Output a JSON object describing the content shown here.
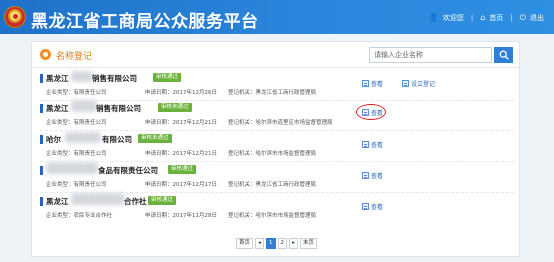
{
  "header": {
    "site_title": "黑龙江省工商局公众服务平台",
    "user_name": "欢迎您",
    "nav_home": "首页",
    "nav_logout": "退出"
  },
  "card": {
    "title": "名称登记",
    "search_placeholder": "请输入企业名称"
  },
  "records": [
    {
      "name_prefix": "黑龙江",
      "name_suffix": "销售有限公司",
      "badge": "审核通过",
      "company_type": "企业类型：有限责任公司",
      "apply_date": "申请日期：2017年12月26日",
      "authority": "登记机关：黑龙江省工商行政管理局",
      "actions": [
        "查看",
        "设立登记"
      ]
    },
    {
      "name_prefix": "黑龙江",
      "name_suffix": "销售有限公司",
      "badge": "审核未通过",
      "company_type": "企业类型：有限责任公司",
      "apply_date": "申请日期：2017年12月21日",
      "authority": "登记机关：哈尔滨市道里区市场监督管理局",
      "actions": [
        "查看"
      ]
    },
    {
      "name_prefix": "哈尔",
      "name_suffix": "有限公司",
      "badge": "审核未通过",
      "company_type": "企业类型：有限责任公司",
      "apply_date": "申请日期：2017年12月21日",
      "authority": "登记机关：哈尔滨市市场监督管理局",
      "actions": [
        "查看"
      ]
    },
    {
      "name_prefix": "",
      "name_suffix": "食品有限责任公司",
      "badge": "审核通过",
      "company_type": "企业类型：有限责任公司",
      "apply_date": "申请日期：2017年12月17日",
      "authority": "登记机关：黑龙江省工商行政管理局",
      "actions": [
        "查看"
      ]
    },
    {
      "name_prefix": "黑龙江",
      "name_suffix": "合作社",
      "badge": "审核通过",
      "company_type": "企业类型：农民专业合作社",
      "apply_date": "申请日期：2017年11月28日",
      "authority": "登记机关：哈尔滨市市场监督管理局",
      "actions": [
        "查看"
      ]
    }
  ],
  "pagination": {
    "first": "首页",
    "prev": "◂",
    "pages": [
      "1",
      "2"
    ],
    "next": "▸",
    "last": "末页",
    "current_page": "1"
  },
  "colors": {
    "header_blue": "#2a86dc",
    "accent_orange": "#f28c1e",
    "badge_green": "#6ab23c",
    "highlight_red": "#e0211f"
  }
}
